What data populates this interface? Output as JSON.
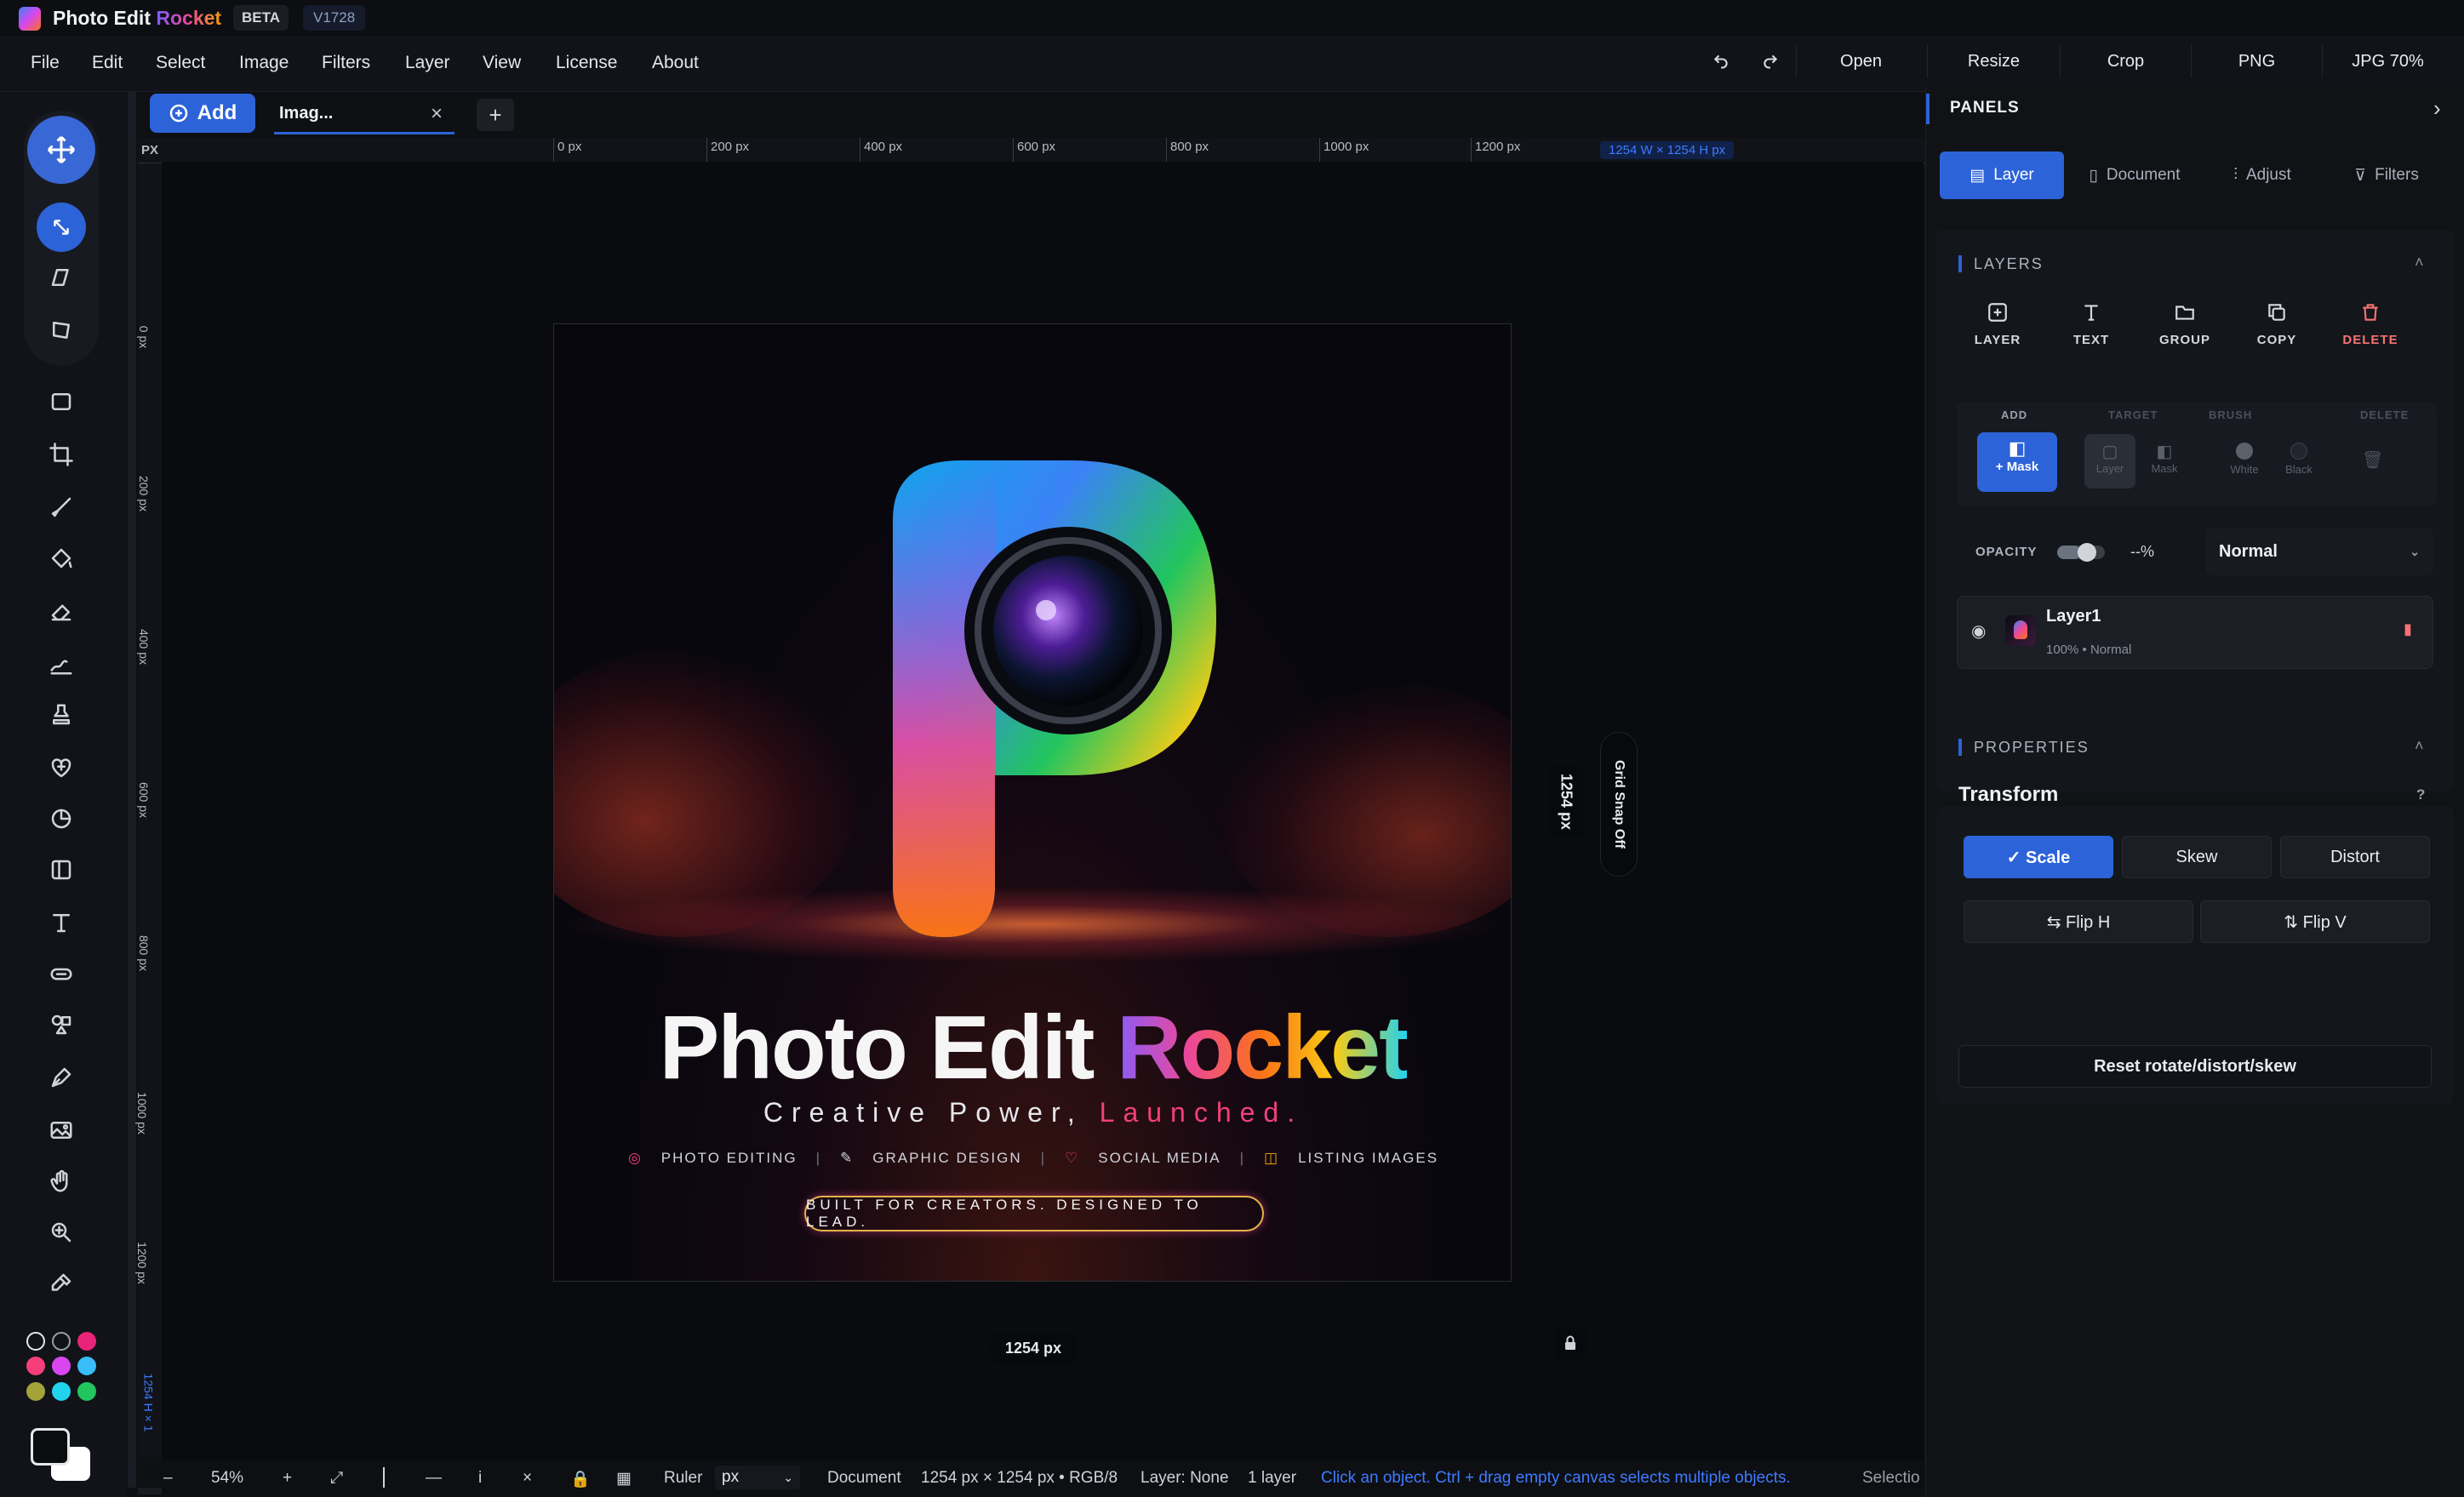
{
  "app": {
    "name_part1": "Photo Edit",
    "name_part2": "Rocket",
    "beta": "BETA",
    "version": "V1728"
  },
  "menu": [
    "File",
    "Edit",
    "Select",
    "Image",
    "Filters",
    "Layer",
    "View",
    "License",
    "About"
  ],
  "top_actions": {
    "undo_icon": "undo-icon",
    "redo_icon": "redo-icon",
    "open": "Open",
    "resize": "Resize",
    "crop": "Crop",
    "png": "PNG",
    "jpg": "JPG 70%"
  },
  "tabs": {
    "add": "Add",
    "doc_tab": "Imag...",
    "close": "×",
    "new": "+"
  },
  "ruler": {
    "unit": "PX",
    "h_ticks": [
      "0 px",
      "200 px",
      "400 px",
      "600 px",
      "800 px",
      "1000 px",
      "1200 px"
    ],
    "size_readout": "1254 W × 1254 H px",
    "v_ticks": [
      "0 px",
      "200 px",
      "400 px",
      "600 px",
      "800 px",
      "1000 px",
      "1200 px"
    ],
    "v_readout": "1254 H × 1"
  },
  "canvas": {
    "width_label": "1254 px",
    "height_label": "1254 px",
    "grid_snap": "Grid Snap Off"
  },
  "artwork": {
    "title_a": "Photo Edit",
    "title_b": "Rocket",
    "tagline_a": "Creative Power,",
    "tagline_b": "Launched.",
    "features": [
      "PHOTO EDITING",
      "GRAPHIC DESIGN",
      "SOCIAL MEDIA",
      "LISTING IMAGES"
    ],
    "badge": "BUILT FOR CREATORS. DESIGNED TO LEAD."
  },
  "swatches": [
    "#ffffff",
    "#9aa0a8",
    "#e9237a",
    "#f43f7a",
    "#d946ef",
    "#38bdf8",
    "#a3a33a",
    "#22d3ee",
    "#22c55e"
  ],
  "panel": {
    "title": "PANELS",
    "tabs": [
      "Layer",
      "Document",
      "Adjust",
      "Filters"
    ],
    "layers_title": "LAYERS",
    "layer_actions": [
      "LAYER",
      "TEXT",
      "GROUP",
      "COPY",
      "DELETE"
    ],
    "mask_heads": [
      "ADD",
      "TARGET",
      "BRUSH",
      "DELETE"
    ],
    "mask_add": "+ Mask",
    "target_opts": [
      "Layer",
      "Mask"
    ],
    "brush_opts": [
      "White",
      "Black"
    ],
    "opacity_label": "OPACITY",
    "opacity_value": "--%",
    "opacity_fraction": 0.5,
    "blend": "Normal",
    "layer": {
      "name": "Layer1",
      "meta": "100% • Normal"
    },
    "properties_title": "PROPERTIES",
    "transform_title": "Transform",
    "help": "?",
    "transform_modes": [
      "✓ Scale",
      "Skew",
      "Distort"
    ],
    "flip_h": "⇆ Flip H",
    "flip_v": "⇅ Flip V",
    "reset": "Reset rotate/distort/skew"
  },
  "status": {
    "minus": "–",
    "zoom": "54%",
    "plus": "+",
    "fit": "⤢",
    "dash": "—",
    "info": "i",
    "x": "×",
    "ruler_label": "Ruler",
    "unit": "px",
    "doc": "Document",
    "dims": "1254 px × 1254 px • RGB/8",
    "layer": "Layer: None",
    "layers": "1 layer",
    "hint": "Click an object. Ctrl + drag empty canvas selects multiple objects.",
    "sel": "Selectio"
  }
}
